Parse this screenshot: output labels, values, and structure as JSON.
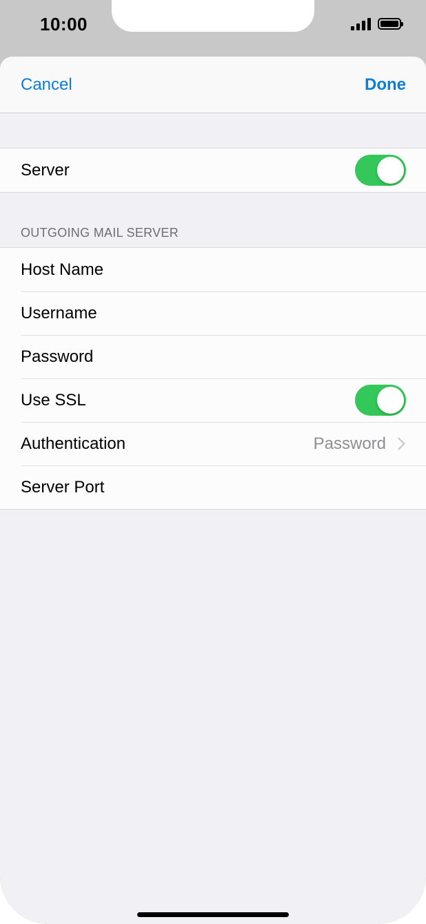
{
  "status_bar": {
    "time": "10:00",
    "icons": [
      "signal-icon",
      "battery-icon"
    ]
  },
  "navbar": {
    "cancel_label": "Cancel",
    "done_label": "Done"
  },
  "server_group": {
    "server_label": "Server",
    "server_enabled": true
  },
  "outgoing": {
    "header": "OUTGOING MAIL SERVER",
    "host_name_label": "Host Name",
    "username_label": "Username",
    "password_label": "Password",
    "use_ssl_label": "Use SSL",
    "use_ssl_enabled": true,
    "authentication_label": "Authentication",
    "authentication_value": "Password",
    "server_port_label": "Server Port"
  },
  "colors": {
    "accent": "#0a7fd9",
    "toggle_on": "#34c759",
    "background": "#f0f0f5"
  }
}
